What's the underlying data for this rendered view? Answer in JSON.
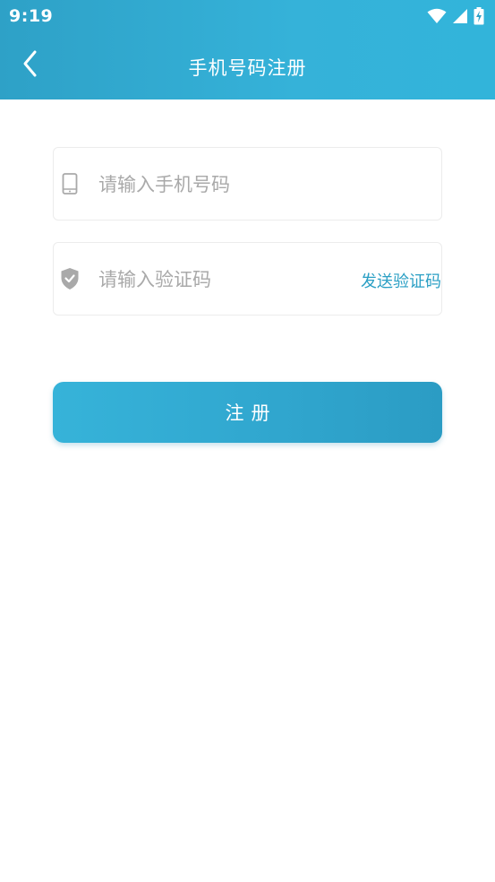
{
  "status_bar": {
    "time": "9:19",
    "icons": [
      "wifi-icon",
      "signal-icon",
      "battery-charging-icon"
    ]
  },
  "app_bar": {
    "back_icon": "chevron-left-icon",
    "title": "手机号码注册"
  },
  "form": {
    "phone": {
      "icon": "phone-icon",
      "placeholder": "请输入手机号码",
      "value": ""
    },
    "code": {
      "icon": "shield-check-icon",
      "placeholder": "请输入验证码",
      "value": "",
      "send_label": "发送验证码"
    },
    "submit_label": "注册"
  },
  "colors": {
    "accent": "#32afd6",
    "accent_dark": "#2a9fc4",
    "placeholder": "#a9a9a9",
    "border": "#ececec"
  }
}
